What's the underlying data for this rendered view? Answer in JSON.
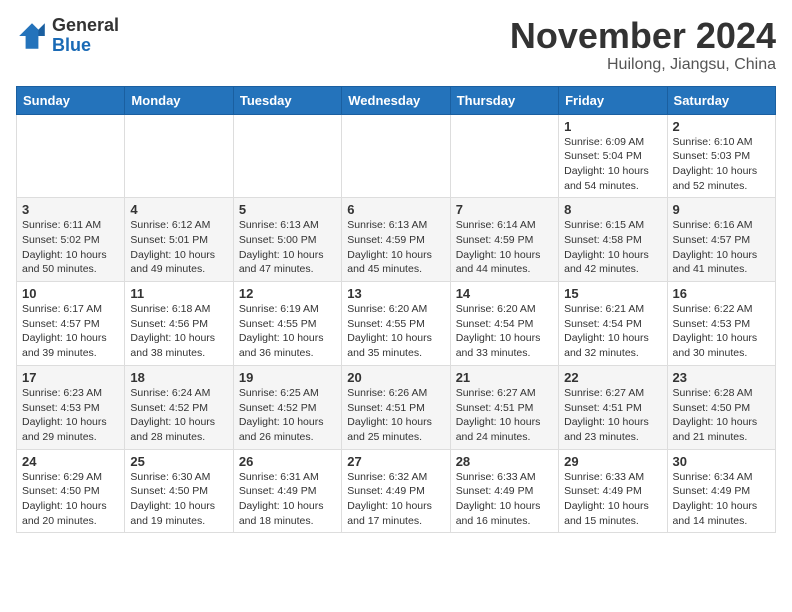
{
  "header": {
    "logo_general": "General",
    "logo_blue": "Blue",
    "month_title": "November 2024",
    "location": "Huilong, Jiangsu, China"
  },
  "weekdays": [
    "Sunday",
    "Monday",
    "Tuesday",
    "Wednesday",
    "Thursday",
    "Friday",
    "Saturday"
  ],
  "weeks": [
    [
      {
        "day": "",
        "info": ""
      },
      {
        "day": "",
        "info": ""
      },
      {
        "day": "",
        "info": ""
      },
      {
        "day": "",
        "info": ""
      },
      {
        "day": "",
        "info": ""
      },
      {
        "day": "1",
        "info": "Sunrise: 6:09 AM\nSunset: 5:04 PM\nDaylight: 10 hours\nand 54 minutes."
      },
      {
        "day": "2",
        "info": "Sunrise: 6:10 AM\nSunset: 5:03 PM\nDaylight: 10 hours\nand 52 minutes."
      }
    ],
    [
      {
        "day": "3",
        "info": "Sunrise: 6:11 AM\nSunset: 5:02 PM\nDaylight: 10 hours\nand 50 minutes."
      },
      {
        "day": "4",
        "info": "Sunrise: 6:12 AM\nSunset: 5:01 PM\nDaylight: 10 hours\nand 49 minutes."
      },
      {
        "day": "5",
        "info": "Sunrise: 6:13 AM\nSunset: 5:00 PM\nDaylight: 10 hours\nand 47 minutes."
      },
      {
        "day": "6",
        "info": "Sunrise: 6:13 AM\nSunset: 4:59 PM\nDaylight: 10 hours\nand 45 minutes."
      },
      {
        "day": "7",
        "info": "Sunrise: 6:14 AM\nSunset: 4:59 PM\nDaylight: 10 hours\nand 44 minutes."
      },
      {
        "day": "8",
        "info": "Sunrise: 6:15 AM\nSunset: 4:58 PM\nDaylight: 10 hours\nand 42 minutes."
      },
      {
        "day": "9",
        "info": "Sunrise: 6:16 AM\nSunset: 4:57 PM\nDaylight: 10 hours\nand 41 minutes."
      }
    ],
    [
      {
        "day": "10",
        "info": "Sunrise: 6:17 AM\nSunset: 4:57 PM\nDaylight: 10 hours\nand 39 minutes."
      },
      {
        "day": "11",
        "info": "Sunrise: 6:18 AM\nSunset: 4:56 PM\nDaylight: 10 hours\nand 38 minutes."
      },
      {
        "day": "12",
        "info": "Sunrise: 6:19 AM\nSunset: 4:55 PM\nDaylight: 10 hours\nand 36 minutes."
      },
      {
        "day": "13",
        "info": "Sunrise: 6:20 AM\nSunset: 4:55 PM\nDaylight: 10 hours\nand 35 minutes."
      },
      {
        "day": "14",
        "info": "Sunrise: 6:20 AM\nSunset: 4:54 PM\nDaylight: 10 hours\nand 33 minutes."
      },
      {
        "day": "15",
        "info": "Sunrise: 6:21 AM\nSunset: 4:54 PM\nDaylight: 10 hours\nand 32 minutes."
      },
      {
        "day": "16",
        "info": "Sunrise: 6:22 AM\nSunset: 4:53 PM\nDaylight: 10 hours\nand 30 minutes."
      }
    ],
    [
      {
        "day": "17",
        "info": "Sunrise: 6:23 AM\nSunset: 4:53 PM\nDaylight: 10 hours\nand 29 minutes."
      },
      {
        "day": "18",
        "info": "Sunrise: 6:24 AM\nSunset: 4:52 PM\nDaylight: 10 hours\nand 28 minutes."
      },
      {
        "day": "19",
        "info": "Sunrise: 6:25 AM\nSunset: 4:52 PM\nDaylight: 10 hours\nand 26 minutes."
      },
      {
        "day": "20",
        "info": "Sunrise: 6:26 AM\nSunset: 4:51 PM\nDaylight: 10 hours\nand 25 minutes."
      },
      {
        "day": "21",
        "info": "Sunrise: 6:27 AM\nSunset: 4:51 PM\nDaylight: 10 hours\nand 24 minutes."
      },
      {
        "day": "22",
        "info": "Sunrise: 6:27 AM\nSunset: 4:51 PM\nDaylight: 10 hours\nand 23 minutes."
      },
      {
        "day": "23",
        "info": "Sunrise: 6:28 AM\nSunset: 4:50 PM\nDaylight: 10 hours\nand 21 minutes."
      }
    ],
    [
      {
        "day": "24",
        "info": "Sunrise: 6:29 AM\nSunset: 4:50 PM\nDaylight: 10 hours\nand 20 minutes."
      },
      {
        "day": "25",
        "info": "Sunrise: 6:30 AM\nSunset: 4:50 PM\nDaylight: 10 hours\nand 19 minutes."
      },
      {
        "day": "26",
        "info": "Sunrise: 6:31 AM\nSunset: 4:49 PM\nDaylight: 10 hours\nand 18 minutes."
      },
      {
        "day": "27",
        "info": "Sunrise: 6:32 AM\nSunset: 4:49 PM\nDaylight: 10 hours\nand 17 minutes."
      },
      {
        "day": "28",
        "info": "Sunrise: 6:33 AM\nSunset: 4:49 PM\nDaylight: 10 hours\nand 16 minutes."
      },
      {
        "day": "29",
        "info": "Sunrise: 6:33 AM\nSunset: 4:49 PM\nDaylight: 10 hours\nand 15 minutes."
      },
      {
        "day": "30",
        "info": "Sunrise: 6:34 AM\nSunset: 4:49 PM\nDaylight: 10 hours\nand 14 minutes."
      }
    ]
  ]
}
